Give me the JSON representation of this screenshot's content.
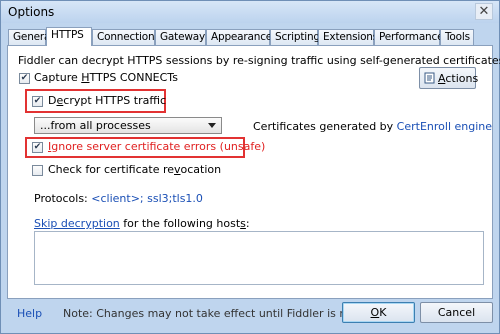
{
  "window": {
    "title": "Options",
    "close_glyph": "✕"
  },
  "tabs": [
    {
      "label": "General",
      "active": false
    },
    {
      "label": "HTTPS",
      "active": true
    },
    {
      "label": "Connections",
      "active": false
    },
    {
      "label": "Gateway",
      "active": false
    },
    {
      "label": "Appearance",
      "active": false
    },
    {
      "label": "Scripting",
      "active": false
    },
    {
      "label": "Extensions",
      "active": false
    },
    {
      "label": "Performance",
      "active": false
    },
    {
      "label": "Tools",
      "active": false
    }
  ],
  "https": {
    "description": "Fiddler can decrypt HTTPS sessions by re-signing traffic using self-generated certificates.",
    "capture": {
      "label_pre": "Capture ",
      "label_accel": "H",
      "label_post": "TTPS CONNECTs",
      "checked": true
    },
    "actions_button": {
      "label_pre": "",
      "label_accel": "A",
      "label_post": "ctions",
      "icon": "actions-icon"
    },
    "decrypt": {
      "label_pre": "D",
      "label_accel": "e",
      "label_post": "crypt HTTPS traffic",
      "checked": true
    },
    "process_select": {
      "value": "...from all processes"
    },
    "cert_generated": {
      "text": "Certificates generated by",
      "link": "CertEnroll engine"
    },
    "ignore_errors": {
      "label_pre": "",
      "label_accel": "I",
      "label_post": "gnore server certificate errors (unsafe)",
      "checked": true,
      "color": "#e02020"
    },
    "revocation": {
      "label_pre": "Check for certificate re",
      "label_accel": "v",
      "label_post": "ocation",
      "checked": false
    },
    "protocols": {
      "label": "Protocols:",
      "value": "<client>; ssl3;tls1.0"
    },
    "skip_decryption": {
      "link": "Skip decryption",
      "text_pre": " for the following host",
      "text_accel": "s",
      "text_post": ":"
    },
    "hosts_value": ""
  },
  "footer": {
    "help": "Help",
    "note": "Note: Changes may not take effect until Fiddler is restarted.",
    "ok": {
      "accel": "O",
      "rest": "K"
    },
    "cancel": "Cancel"
  },
  "colors": {
    "highlight_box": "#e23232",
    "link": "#1a4fb5"
  }
}
